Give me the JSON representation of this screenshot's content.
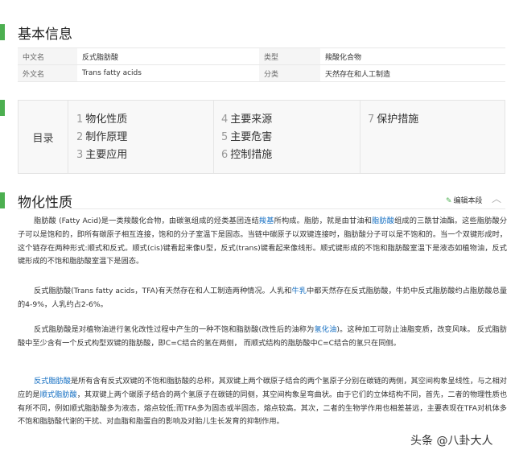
{
  "basic_info": {
    "title": "基本信息",
    "rows": [
      {
        "k1": "中文名",
        "v1": "反式脂肪酸",
        "k2": "类型",
        "v2": "羧酸化合物"
      },
      {
        "k1": "外文名",
        "v1": "Trans fatty acids",
        "k2": "分类",
        "v2": "天然存在和人工制造"
      }
    ]
  },
  "catalog": {
    "label": "目录",
    "items": [
      {
        "num": "1",
        "text": "物化性质"
      },
      {
        "num": "2",
        "text": "制作原理"
      },
      {
        "num": "3",
        "text": "主要应用"
      },
      {
        "num": "4",
        "text": "主要来源"
      },
      {
        "num": "5",
        "text": "主要危害"
      },
      {
        "num": "6",
        "text": "控制措施"
      },
      {
        "num": "7",
        "text": "保护措施"
      }
    ]
  },
  "section": {
    "title": "物化性质",
    "edit_label": "编辑本段",
    "collapse_icon": "chevron-up-icon"
  },
  "paragraphs": [
    [
      {
        "t": "脂肪酸 (Fatty Acid)是一类羧酸化合物，由碳氢组成的烃类基团连结"
      },
      {
        "t": "羧基",
        "link": true
      },
      {
        "t": "所构成。脂肪，就是由甘油和"
      },
      {
        "t": "脂肪酸",
        "link": true
      },
      {
        "t": "组成的三酰甘油酯。这些脂肪酸分子可以是饱和的，即所有碳原子相互连接，饱和的分子室温下是固态。当链中碳原子以双键连接时，脂肪酸分子可以是不饱和的。当一个双键形成时，这个链存在两种形式:顺式和反式。顺式(cis)键看起来像U型，反式(trans)键看起来像线形。顺式键形成的不饱和脂肪酸室温下是液态如植物油，反式键形成的不饱和脂肪酸室温下是固态。"
      }
    ],
    [
      {
        "t": "反式脂肪酸(Trans fatty acids，TFA)有天然存在和人工制造两种情况。人乳和"
      },
      {
        "t": "牛乳",
        "link": true
      },
      {
        "t": "中都天然存在反式脂肪酸，牛奶中反式脂肪酸约占脂肪酸总量的4-9%，人乳约占2-6%。"
      }
    ],
    [
      {
        "t": "反式脂肪酸是对植物油进行氢化改性过程中产生的一种不饱和脂肪酸(改性后的油称为"
      },
      {
        "t": "氢化油",
        "link": true
      },
      {
        "t": ")。这种加工可防止油脂变质，改变风味。 反式脂肪酸中至少含有一个反式构型双键的脂肪酸，即C=C结合的氢在两侧， 而顺式结构的脂肪酸中C=C结合的氢只在同侧。"
      }
    ],
    [
      {
        "t": "反式脂肪酸",
        "link": true
      },
      {
        "t": "是所有含有反式双键的不饱和脂肪酸的总称，其双键上两个碳原子结合的两个氢原子分别在碳链的两侧，其空间构象呈线性，与之相对应的是"
      },
      {
        "t": "顺式脂肪酸",
        "link": true
      },
      {
        "t": "，其双键上两个碳原子结合的两个氢原子在碳链的同侧，其空间构象呈弯曲状。由于它们的立体结构不同，首先，二者的物理性质也有所不同，例如顺式脂肪酸多为液态，熔点较低;而TFA多为固态或半固态，熔点较高。其次，二者的生物学作用也相差甚远，主要表现在TFA对机体多不饱和脂肪酸代谢的干扰、对血脂和脂蛋白的影响及对胎儿生长发育的抑制作用。"
      }
    ]
  ],
  "watermark": "头条 @八卦大人",
  "colors": {
    "accent": "#4caf50",
    "link": "#136ec2"
  }
}
